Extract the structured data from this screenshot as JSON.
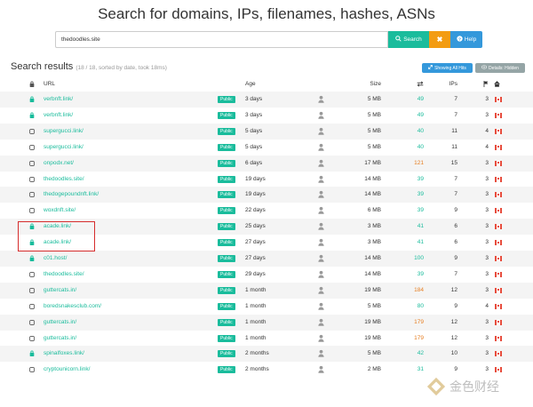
{
  "page": {
    "title": "Search for domains, IPs, filenames, hashes, ASNs"
  },
  "search": {
    "value": "thedoodles.site",
    "search_label": "Search",
    "clear_label": "✖",
    "help_label": "Help"
  },
  "results": {
    "title": "Search results",
    "meta": "(18 / 18, sorted by date, took 18ms)",
    "show_all_label": "Showing All Hits",
    "details_label": "Details: Hidden"
  },
  "table": {
    "headers": {
      "url": "URL",
      "age": "Age",
      "size": "Size",
      "ips": "IPs"
    },
    "rows": [
      {
        "lock": true,
        "url": "verbnft.link/",
        "visibility": "Public",
        "age": "3 days",
        "size": "5 MB",
        "hashes": "49",
        "hash_color": "green",
        "ips": "7",
        "flag": "3"
      },
      {
        "lock": true,
        "url": "verbnft.link/",
        "visibility": "Public",
        "age": "3 days",
        "size": "5 MB",
        "hashes": "49",
        "hash_color": "green",
        "ips": "7",
        "flag": "3"
      },
      {
        "lock": false,
        "url": "supergucci.link/",
        "visibility": "Public",
        "age": "5 days",
        "size": "5 MB",
        "hashes": "40",
        "hash_color": "green",
        "ips": "11",
        "flag": "4"
      },
      {
        "lock": false,
        "url": "supergucci.link/",
        "visibility": "Public",
        "age": "5 days",
        "size": "5 MB",
        "hashes": "40",
        "hash_color": "green",
        "ips": "11",
        "flag": "4"
      },
      {
        "lock": false,
        "url": "onpodx.net/",
        "visibility": "Public",
        "age": "6 days",
        "size": "17 MB",
        "hashes": "121",
        "hash_color": "orange",
        "ips": "15",
        "flag": "3"
      },
      {
        "lock": false,
        "url": "thedoodles.site/",
        "visibility": "Public",
        "age": "19 days",
        "size": "14 MB",
        "hashes": "39",
        "hash_color": "green",
        "ips": "7",
        "flag": "3"
      },
      {
        "lock": false,
        "url": "thedogepoundnft.link/",
        "visibility": "Public",
        "age": "19 days",
        "size": "14 MB",
        "hashes": "39",
        "hash_color": "green",
        "ips": "7",
        "flag": "3"
      },
      {
        "lock": false,
        "url": "woxdnft.site/",
        "visibility": "Public",
        "age": "22 days",
        "size": "6 MB",
        "hashes": "39",
        "hash_color": "green",
        "ips": "9",
        "flag": "3"
      },
      {
        "lock": true,
        "url": "acade.link/",
        "visibility": "Public",
        "age": "25 days",
        "size": "3 MB",
        "hashes": "41",
        "hash_color": "green",
        "ips": "6",
        "flag": "3"
      },
      {
        "lock": true,
        "url": "acade.link/",
        "visibility": "Public",
        "age": "27 days",
        "size": "3 MB",
        "hashes": "41",
        "hash_color": "green",
        "ips": "6",
        "flag": "3"
      },
      {
        "lock": true,
        "url": "c01.host/",
        "visibility": "Public",
        "age": "27 days",
        "size": "14 MB",
        "hashes": "100",
        "hash_color": "green",
        "ips": "9",
        "flag": "3"
      },
      {
        "lock": false,
        "url": "thedoodles.site/",
        "visibility": "Public",
        "age": "29 days",
        "size": "14 MB",
        "hashes": "39",
        "hash_color": "green",
        "ips": "7",
        "flag": "3"
      },
      {
        "lock": false,
        "url": "guttercats.in/",
        "visibility": "Public",
        "age": "1 month",
        "size": "19 MB",
        "hashes": "184",
        "hash_color": "orange",
        "ips": "12",
        "flag": "3"
      },
      {
        "lock": false,
        "url": "boredsnakesclub.com/",
        "visibility": "Public",
        "age": "1 month",
        "size": "5 MB",
        "hashes": "80",
        "hash_color": "green",
        "ips": "9",
        "flag": "4"
      },
      {
        "lock": false,
        "url": "guttercats.in/",
        "visibility": "Public",
        "age": "1 month",
        "size": "19 MB",
        "hashes": "179",
        "hash_color": "orange",
        "ips": "12",
        "flag": "3"
      },
      {
        "lock": false,
        "url": "guttercats.in/",
        "visibility": "Public",
        "age": "1 month",
        "size": "19 MB",
        "hashes": "179",
        "hash_color": "orange",
        "ips": "12",
        "flag": "3"
      },
      {
        "lock": true,
        "url": "spinalfoxes.link/",
        "visibility": "Public",
        "age": "2 months",
        "size": "5 MB",
        "hashes": "42",
        "hash_color": "green",
        "ips": "10",
        "flag": "3"
      },
      {
        "lock": false,
        "url": "cryptounicorn.link/",
        "visibility": "Public",
        "age": "2 months",
        "size": "2 MB",
        "hashes": "31",
        "hash_color": "green",
        "ips": "9",
        "flag": "3"
      }
    ]
  },
  "watermark": {
    "text": "金色财经"
  },
  "colors": {
    "accent": "#1abc9c",
    "warning": "#f39c12",
    "info": "#3498db",
    "hash_high": "#e67e22",
    "highlight": "#d62c2c"
  }
}
